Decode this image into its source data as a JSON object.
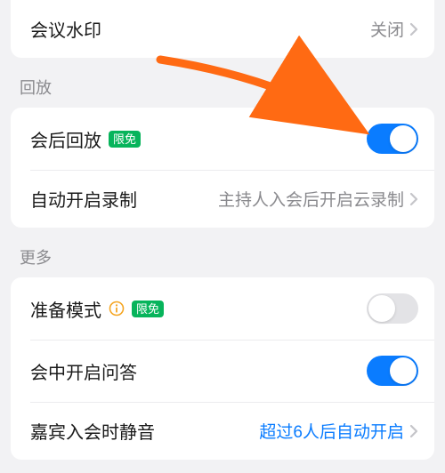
{
  "sections": {
    "top": {
      "watermark": {
        "label": "会议水印",
        "value": "关闭"
      }
    },
    "playback": {
      "header": "回放",
      "afterMeeting": {
        "label": "会后回放",
        "badge": "限免",
        "toggle": true
      },
      "autoRecord": {
        "label": "自动开启录制",
        "value": "主持人入会后开启云录制"
      }
    },
    "more": {
      "header": "更多",
      "prepMode": {
        "label": "准备模式",
        "badge": "限免",
        "toggle": false
      },
      "qa": {
        "label": "会中开启问答",
        "toggle": true
      },
      "guestMute": {
        "label": "嘉宾入会时静音",
        "value": "超过6人后自动开启"
      }
    }
  },
  "colors": {
    "accent": "#0a7cff",
    "badge": "#07b45b",
    "warn": "#f5a623",
    "arrow": "#ff6a13"
  }
}
